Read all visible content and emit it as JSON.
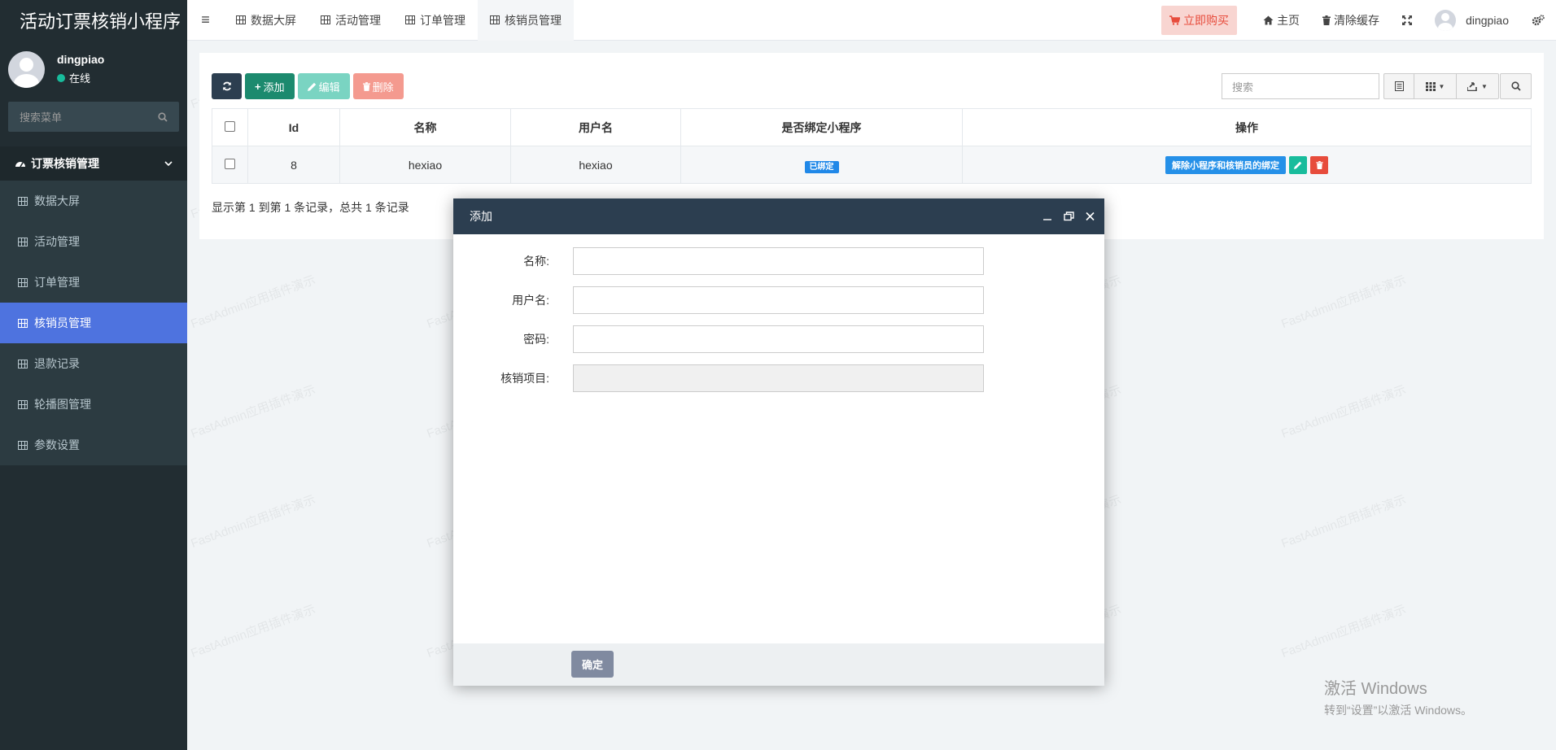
{
  "brand": "活动订票核销小程序",
  "user": {
    "name": "dingpiao",
    "status": "在线"
  },
  "side_search": {
    "placeholder": "搜索菜单"
  },
  "menu": {
    "header": "订票核销管理",
    "items": [
      {
        "label": "数据大屏"
      },
      {
        "label": "活动管理"
      },
      {
        "label": "订单管理"
      },
      {
        "label": "核销员管理",
        "active": true
      },
      {
        "label": "退款记录"
      },
      {
        "label": "轮播图管理"
      },
      {
        "label": "参数设置"
      }
    ]
  },
  "tabs": [
    {
      "label": "数据大屏"
    },
    {
      "label": "活动管理"
    },
    {
      "label": "订单管理"
    },
    {
      "label": "核销员管理",
      "active": true
    }
  ],
  "topright": {
    "buy": "立即购买",
    "home": "主页",
    "clear": "清除缓存",
    "user": "dingpiao"
  },
  "toolbar": {
    "add": "添加",
    "edit": "编辑",
    "delete": "删除"
  },
  "search": {
    "placeholder": "搜索"
  },
  "table": {
    "columns": [
      "Id",
      "名称",
      "用户名",
      "是否绑定小程序",
      "操作"
    ],
    "rows": [
      {
        "id": "8",
        "name": "hexiao",
        "username": "hexiao",
        "bound": "已绑定",
        "op_unbind": "解除小程序和核销员的绑定"
      }
    ]
  },
  "pageinfo": "显示第 1 到第 1 条记录，总共 1 条记录",
  "modal": {
    "title": "添加",
    "fields": [
      {
        "label": "名称:"
      },
      {
        "label": "用户名:"
      },
      {
        "label": "密码:"
      },
      {
        "label": "核销项目:"
      }
    ],
    "ok": "确定"
  },
  "watermark": "FastAdmin应用插件演示",
  "activate": {
    "line1": "激活 Windows",
    "line2": "转到“设置”以激活 Windows。"
  },
  "colors": {
    "sidebar": "#222d32",
    "active": "#4e73df",
    "success": "#18bc9c",
    "danger": "#e74c3c",
    "primary": "#2088e8",
    "modal_header": "#2c3e50"
  }
}
